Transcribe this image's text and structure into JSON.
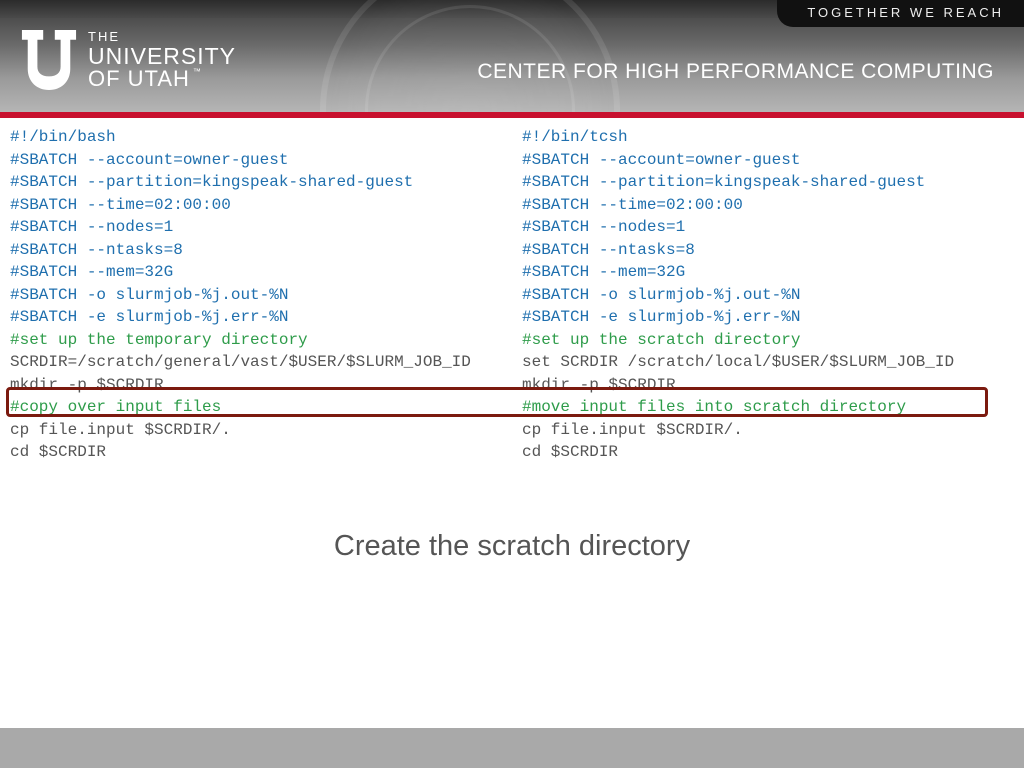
{
  "header": {
    "tagline": "TOGETHER WE REACH",
    "logo_the": "THE",
    "logo_name": "UNIVERSITY",
    "logo_of": "OF UTAH",
    "logo_tm": "™",
    "center_title": "CENTER FOR HIGH PERFORMANCE COMPUTING"
  },
  "left": {
    "l1": "#!/bin/bash",
    "l2": "#SBATCH --account=owner-guest",
    "l3": "#SBATCH --partition=kingspeak-shared-guest",
    "l4": "#SBATCH --time=02:00:00",
    "l5": "#SBATCH --nodes=1",
    "l6": "#SBATCH --ntasks=8",
    "l7": "#SBATCH --mem=32G",
    "l8": "#SBATCH -o slurmjob-%j.out-%N",
    "l9": "#SBATCH -e slurmjob-%j.err-%N",
    "l10": "#set up the temporary directory",
    "l11": "SCRDIR=/scratch/general/vast/$USER/$SLURM_JOB_ID",
    "l12": "mkdir -p $SCRDIR",
    "l13": "#copy over input files",
    "l14": "cp file.input $SCRDIR/.",
    "l15": "cd $SCRDIR"
  },
  "right": {
    "l1": "#!/bin/tcsh",
    "l2": "#SBATCH --account=owner-guest",
    "l3": "#SBATCH --partition=kingspeak-shared-guest",
    "l4": "#SBATCH --time=02:00:00",
    "l5": "#SBATCH --nodes=1",
    "l6": "#SBATCH --ntasks=8",
    "l7": "#SBATCH --mem=32G",
    "l8": "#SBATCH -o slurmjob-%j.out-%N",
    "l9": "#SBATCH -e slurmjob-%j.err-%N",
    "l10": "#set up the scratch directory",
    "l11": "set SCRDIR /scratch/local/$USER/$SLURM_JOB_ID",
    "l12": "mkdir -p $SCRDIR",
    "l13": "#move input files into scratch directory",
    "l14": "cp file.input $SCRDIR/.",
    "l15": "cd $SCRDIR"
  },
  "caption": "Create the scratch directory"
}
